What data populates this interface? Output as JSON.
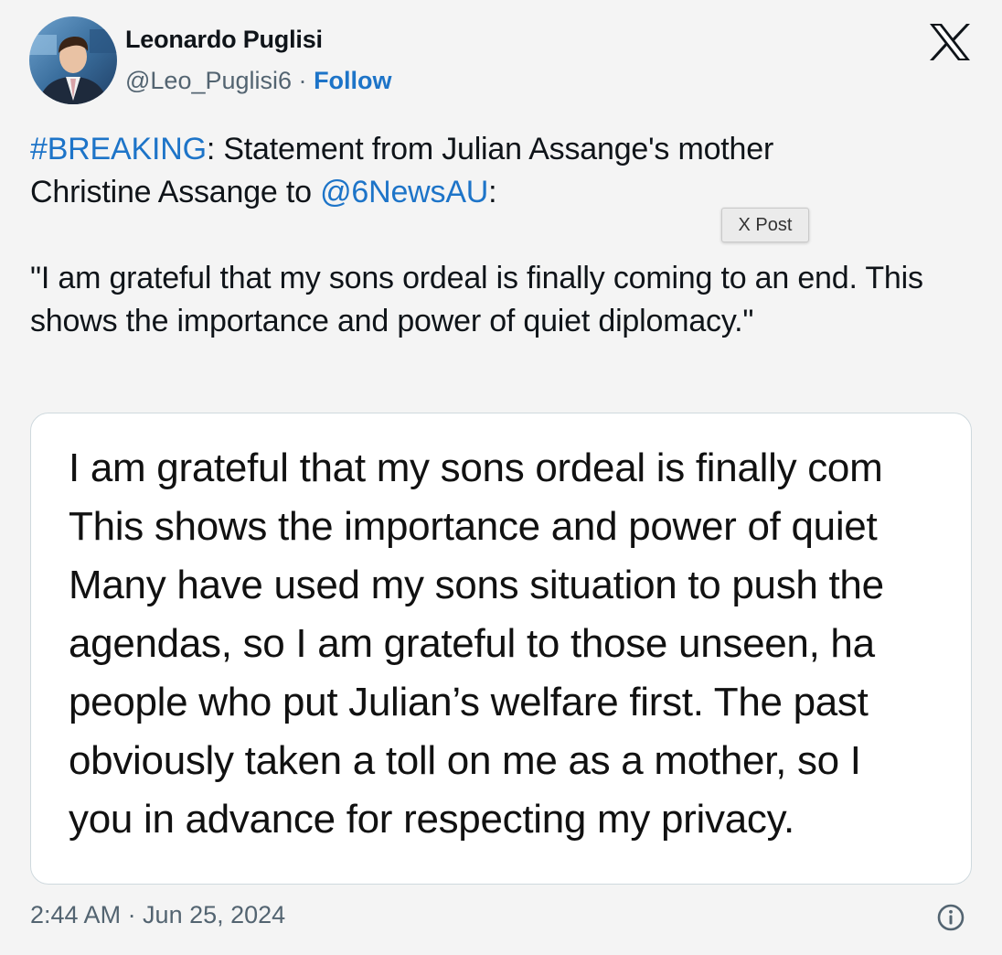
{
  "author": {
    "name": "Leonardo Puglisi",
    "handle": "@Leo_Puglisi6",
    "separator": "·",
    "follow_label": "Follow"
  },
  "platform_icon": "x-logo-icon",
  "tweet": {
    "hashtag": "#BREAKING",
    "line1_text": ": Statement from Julian Assange's mother",
    "line2_text": "Christine Assange to ",
    "mention": "@6NewsAU",
    "mention_suffix": ":",
    "quote": "\"I am grateful that my sons ordeal is finally coming to an end. This shows the importance and power of quiet diplomacy.\""
  },
  "tooltip": "X Post",
  "media": {
    "lines": [
      "I am grateful that my sons ordeal is finally com",
      "This shows the importance and power of quiet",
      "Many have used my sons situation to push the",
      "agendas, so I am grateful to those unseen, ha",
      "people who put Julian’s welfare first. The past",
      "obviously taken a toll on me as a mother, so I",
      "you in advance for respecting my privacy."
    ]
  },
  "footer": {
    "timestamp": "2:44 AM · Jun 25, 2024",
    "info_icon": "info-icon"
  },
  "colors": {
    "link": "#1d74c8",
    "secondary_text": "#536471",
    "background": "#f4f4f4",
    "card_border": "#cfd9de"
  }
}
